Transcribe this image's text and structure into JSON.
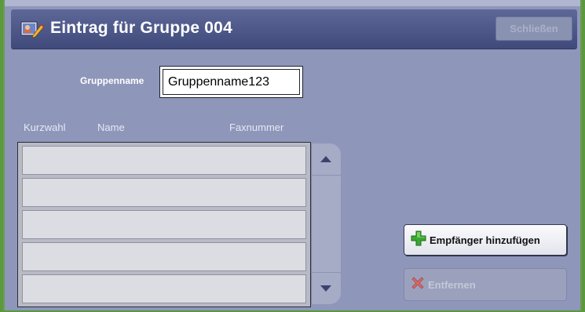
{
  "header": {
    "title": "Eintrag für Gruppe 004",
    "close_label": "Schließen"
  },
  "group": {
    "name_label": "Gruppenname",
    "name_value": "Gruppenname123"
  },
  "list": {
    "columns": [
      "Kurzwahl",
      "Name",
      "Faxnummer"
    ],
    "rows": [
      "",
      "",
      "",
      "",
      ""
    ]
  },
  "actions": {
    "add_label": "Empfänger hinzufügen",
    "remove_label": "Entfernen"
  },
  "icons": {
    "header": "address-book-edit-icon",
    "add": "green-plus-icon",
    "remove": "red-x-icon",
    "scroll_up": "triangle-up-icon",
    "scroll_down": "triangle-down-icon"
  },
  "colors": {
    "background": "#8e96ba",
    "header_bar": "#4a5585",
    "frame_border": "#5a9a3c",
    "add_icon": "#3aa832",
    "remove_icon": "#d86a6a"
  }
}
